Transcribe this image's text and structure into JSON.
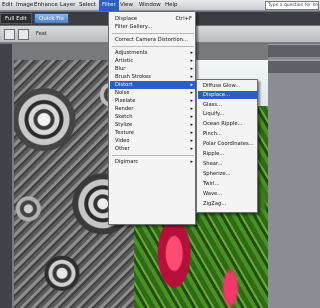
{
  "menubar": {
    "items": [
      "Edit",
      "Image",
      "Enhance",
      "Layer",
      "Select",
      "Filter",
      "View",
      "Window",
      "Help"
    ],
    "help_placeholder": "Type a question for help"
  },
  "tabs": {
    "full_edit": "Full Edit",
    "quick_fix": "Quick Fix"
  },
  "options": {
    "feather_label": "Feat"
  },
  "filter_menu": {
    "top_items": [
      {
        "label": "Displace",
        "shortcut": "Ctrl+F"
      },
      {
        "label": "Filter Gallery..."
      }
    ],
    "camera_item": "Correct Camera Distortion...",
    "submenus": [
      "Adjustments",
      "Artistic",
      "Blur",
      "Brush Strokes",
      "Distort",
      "Noise",
      "Pixelate",
      "Render",
      "Sketch",
      "Stylize",
      "Texture",
      "Video",
      "Other"
    ],
    "digimarc": "Digimarc",
    "arrow": "▸"
  },
  "distort_menu": {
    "items": [
      "Diffuse Glow...",
      "Displace...",
      "Glass...",
      "Liquify...",
      "Ocean Ripple...",
      "Pinch...",
      "Polar Coordinates...",
      "Ripple...",
      "Shear...",
      "Spherize...",
      "Twirl...",
      "Wave...",
      "ZigZag..."
    ]
  },
  "colors": {
    "highlight": "#2b5fc0",
    "menu_bg": "#f4f4f4"
  }
}
